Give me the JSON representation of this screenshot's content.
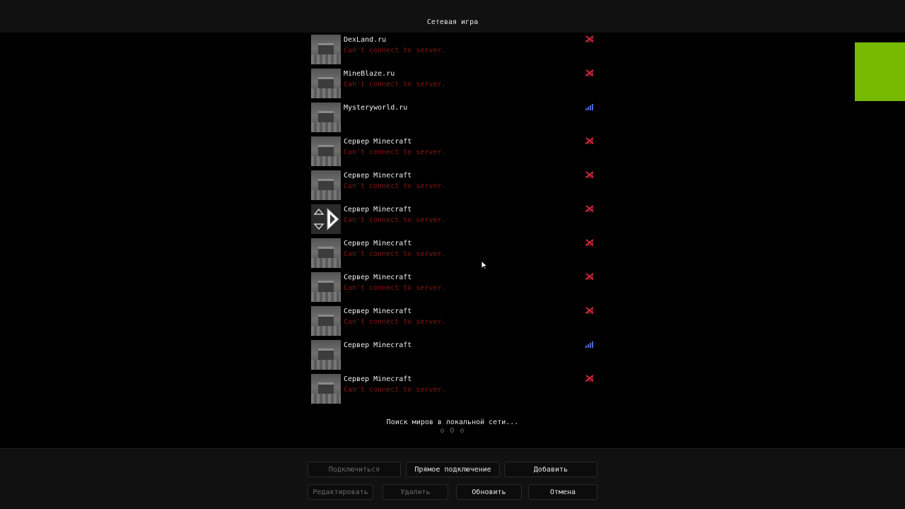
{
  "window": {
    "title": "Сетевая игра"
  },
  "servers": [
    {
      "name": "DexLand.ru",
      "status": "Can't connect to server.",
      "ping": "no-connection-icon"
    },
    {
      "name": "MineBlaze.ru",
      "status": "Can't connect to server.",
      "ping": "no-connection-icon"
    },
    {
      "name": "Mysteryworld.ru",
      "status": "",
      "ping": "signal-bars-icon"
    },
    {
      "name": "Сервер Minecraft",
      "status": "Can't connect to server.",
      "ping": "no-connection-icon"
    },
    {
      "name": "Сервер Minecraft",
      "status": "Can't connect to server.",
      "ping": "no-connection-icon"
    },
    {
      "name": "Сервер Minecraft",
      "status": "Can't connect to server.",
      "ping": "no-connection-icon"
    },
    {
      "name": "Сервер Minecraft",
      "status": "Can't connect to server.",
      "ping": "no-connection-icon"
    },
    {
      "name": "Сервер Minecraft",
      "status": "Can't connect to server.",
      "ping": "no-connection-icon"
    },
    {
      "name": "Сервер Minecraft",
      "status": "Can't connect to server.",
      "ping": "no-connection-icon"
    },
    {
      "name": "Сервер Minecraft",
      "status": "",
      "ping": "signal-bars-icon"
    },
    {
      "name": "Сервер Minecraft",
      "status": "Can't connect to server.",
      "ping": "no-connection-icon"
    }
  ],
  "lan": {
    "searching": "Поиск миров в локальной сети...",
    "dots": "o O o"
  },
  "buttons": {
    "join": "Подключиться",
    "direct": "Прямое подключение",
    "add": "Добавить",
    "edit": "Редактировать",
    "delete": "Удалить",
    "refresh": "Обновить",
    "cancel": "Отмена"
  },
  "colors": {
    "error_text": "#8a1414",
    "ping_error": "#c8283c",
    "ping_good": "#4a6ad0",
    "overlay_green": "#76b900"
  }
}
